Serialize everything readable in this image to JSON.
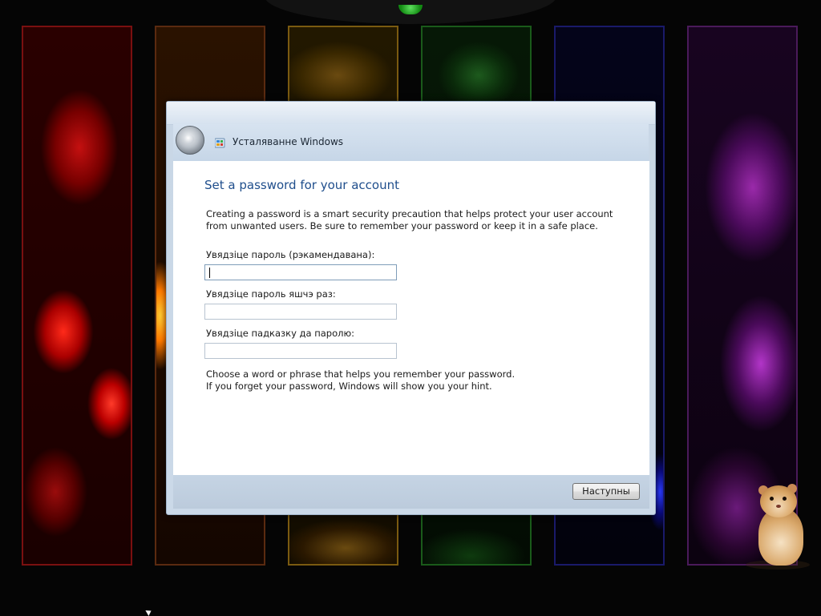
{
  "window": {
    "title": "Усталяванне Windows"
  },
  "page": {
    "heading": "Set a password for your account",
    "description": "Creating a password is a smart security precaution that helps protect your user account from unwanted users. Be sure to remember your password or keep it in a safe place.",
    "hint_text": "Choose a word or phrase that helps you remember your password.\nIf you forget your password, Windows will show you your hint."
  },
  "form": {
    "password_label": "Увядзіце пароль (рэкамендавана):",
    "password_value": "",
    "confirm_label": "Увядзіце пароль яшчэ раз:",
    "confirm_value": "",
    "hint_label": "Увядзіце падказку да паролю:",
    "hint_value": ""
  },
  "footer": {
    "next_label": "Наступны"
  },
  "icons": {
    "back": "back-arrow-icon",
    "app": "windows-setup-icon"
  },
  "colors": {
    "heading": "#1f4e8c",
    "chrome": "#c6d6e7"
  }
}
